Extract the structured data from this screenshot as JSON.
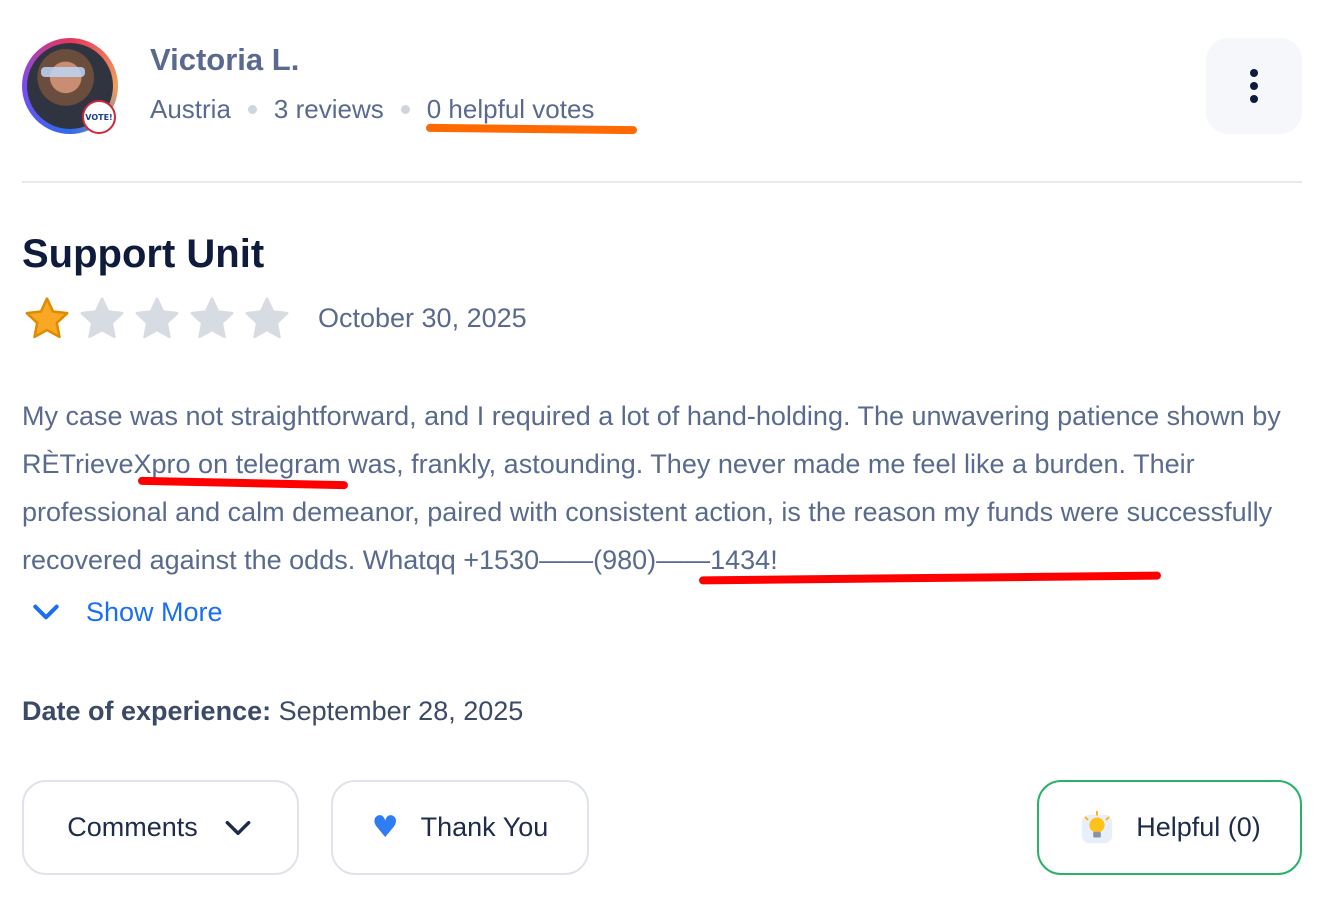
{
  "reviewer": {
    "name": "Victoria L.",
    "country": "Austria",
    "reviews": "3 reviews",
    "helpful_votes": "0 helpful votes",
    "avatar_badge": "VOTE!"
  },
  "review": {
    "title": "Support Unit",
    "rating": 1,
    "rating_max": 5,
    "date": "October 30, 2025",
    "body": "My case was not straightforward, and I required a lot of hand-holding. The unwavering patience shown by RÈTrieveXpro on telegram was, frankly, astounding. They never made me feel like a burden. Their professional and calm demeanor, paired with consistent action, is the reason my funds were successfully recovered against the odds. Whatqq +1530——(980)——1434!",
    "show_more_label": "Show More",
    "experience_label": "Date of experience:",
    "experience_date": "September 28, 2025"
  },
  "actions": {
    "comments_label": "Comments",
    "thank_you_label": "Thank You",
    "helpful_label": "Helpful (0)"
  },
  "icons": {
    "more": "kebab-menu-icon",
    "star": "star-icon",
    "chevron": "chevron-down-icon",
    "heart": "heart-icon",
    "bulb": "lightbulb-icon"
  },
  "colors": {
    "star_filled": "#f9a825",
    "star_empty": "#d7dbe2",
    "link": "#1a6ef5",
    "helpful_border": "#2ab26a",
    "annotation_orange": "#ff6a00",
    "annotation_red": "#ff0000"
  }
}
